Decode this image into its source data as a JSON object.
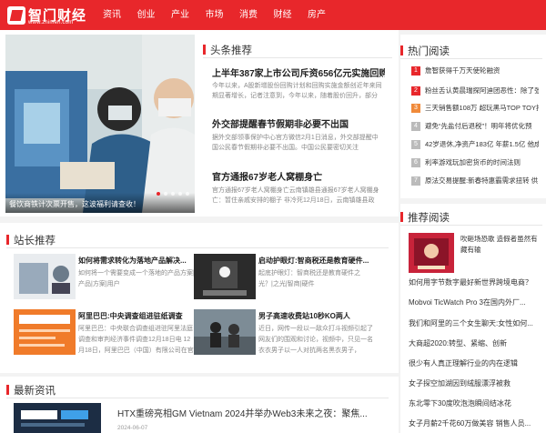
{
  "header": {
    "logo_text": "智门财经",
    "logo_sub": "www.zhimen.com",
    "nav": [
      "资讯",
      "创业",
      "产业",
      "市场",
      "消费",
      "财经",
      "房产"
    ]
  },
  "featured": {
    "caption": "餐饮商铁计次票开售，这波福利请查收！"
  },
  "headlines": {
    "title": "头条推荐",
    "items": [
      {
        "title": "上半年387家上市公司斥资656亿元实施回购",
        "summary": "今年以来，A股新增股份回购计划和回购实施金额创近年来同期显著增长，记者注意到，今年以来，随着股价回升，部分"
      },
      {
        "title": "外交部提醒春节假期非必要不出国",
        "summary": "据外交部领事保护中心官方微信2月1日消息，外交部提醒中国公民春节假期非必要不出国。中国公民要密切关注"
      },
      {
        "title": "官方通报67岁老人窝棚身亡",
        "summary": "官方通报67岁老人窝棚身亡云南镇雄县通报67岁老人窝棚身亡：暂住亲戚安排的棚子 非冷死12月18日，云南镇雄县政"
      }
    ]
  },
  "hot_reading": {
    "title": "热门阅读",
    "items": [
      {
        "num": "1",
        "text": "詹智获得千万天使轮融资"
      },
      {
        "num": "2",
        "text": "粉丝舌认黄晨瑞探阿迪团恶性：除了张"
      },
      {
        "num": "3",
        "text": "三天销售额108万 超玩黑马TOP TOY打"
      },
      {
        "num": "4",
        "text": "避免“先盐付后退税”！明年将优化预"
      },
      {
        "num": "5",
        "text": "42岁退休,净资产183亿 年薪1.5亿 他成"
      },
      {
        "num": "6",
        "text": "利率游戏玩加密货币的时间法则"
      },
      {
        "num": "7",
        "text": "原法交易提醒:新春特惠霸需求扭转 供"
      }
    ]
  },
  "station": {
    "title": "站长推荐",
    "items": [
      {
        "title": "如何将需求转化为落地产品解决...",
        "summary": "如何将一个需要变成一个落地的产品方案|产品|方案|用户"
      },
      {
        "title": "启动护眼灯:智商税还是教育硬件...",
        "summary": "起底护眼灯：智商税还是教育硬件之光？|之光|智商|硬件"
      },
      {
        "title": "阿里巴巴:中央调查组进驻纸调查",
        "summary": "阿里巴巴：中央联合调查组进驻阿里法庭调查和审判经济事件调查12月18日电 12月18日，阿里巴巴（中国）有限公司在官博发布"
      },
      {
        "title": "男子高速收费站10秒KO两人",
        "summary": "近日，网传一段以一敌众打斗视频引起了网友们的围观和讨论，视频中，只见一名衣衣男子以一人对抗两名黑衣男子，"
      }
    ]
  },
  "recommend": {
    "title": "推荐阅读",
    "card_text": "吹砸场恐歌 造假者虽然有藏有输",
    "links": [
      "如何用字节数字最好新世界跨境电商？",
      "Mobvoi TicWatch Pro 3在国内外厂...",
      "我们和阿里的三个女生聊天:女性如何...",
      "大商超2020:转型、紧缩、创新",
      "很少有人真正理解行业的内在逻辑",
      "女子探空加湖因到绒服漂浮被救",
      "东北零下30度吹泡泡瞬间结冰花",
      "女子月薪2千花60万做美容 销售人员..."
    ]
  },
  "news": {
    "title": "最新资讯",
    "item_title": "HTX重磅亮相GM Vietnam 2024并举办Web3未来之夜：聚焦...",
    "item_date": "2024-06-07"
  },
  "colors": {
    "brand": "#e8272b",
    "page_bg": "#f3f3f3"
  }
}
